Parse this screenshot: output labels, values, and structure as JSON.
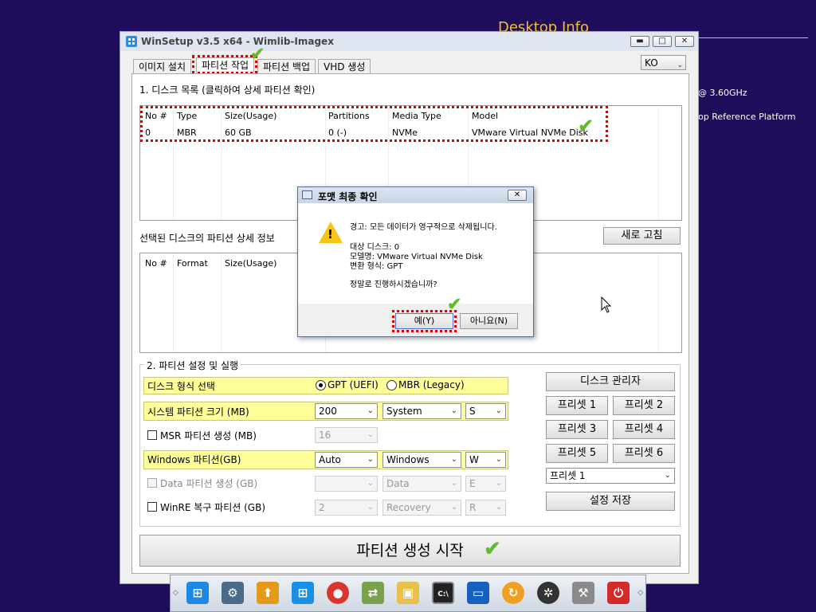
{
  "desktop": {
    "title": "Desktop Info",
    "cpu_text": "@ 3.60GHz",
    "platform_text": "op Reference Platform"
  },
  "window": {
    "title": "WinSetup v3.5 x64 - Wimlib-Imagex",
    "language": "KO",
    "tabs": [
      "이미지 설치",
      "파티션 작업",
      "파티션 백업",
      "VHD 생성"
    ],
    "active_tab": 1
  },
  "disk_list": {
    "section_label": "1. 디스크 목록 (클릭하여 상세 파티션 확인)",
    "columns": [
      "No #",
      "Type",
      "Size(Usage)",
      "Partitions",
      "Media Type",
      "Model"
    ],
    "rows": [
      [
        "0",
        "MBR",
        "60 GB",
        "0 (-)",
        "NVMe",
        "VMware Virtual NVMe Disk"
      ]
    ]
  },
  "partition_detail": {
    "section_label": "선택된 디스크의 파티션 상세 정보",
    "columns": [
      "No #",
      "Format",
      "Size(Usage)"
    ],
    "refresh_button": "새로 고침"
  },
  "settings": {
    "group_label": "2. 파티션 설정 및 실행",
    "disk_format_label": "디스크 형식 선택",
    "gpt_option": "GPT (UEFI)",
    "mbr_option": "MBR (Legacy)",
    "selected_format": "GPT",
    "system_partition_label": "시스템 파티션 크기 (MB)",
    "system_size": "200",
    "system_label": "System",
    "system_letter": "S",
    "msr_label": "MSR 파티션 생성 (MB)",
    "msr_size": "16",
    "windows_label": "Windows 파티션(GB)",
    "windows_size": "Auto",
    "windows_name": "Windows",
    "windows_letter": "W",
    "data_label": "Data 파티션 생성 (GB)",
    "data_size": "",
    "data_name": "Data",
    "data_letter": "E",
    "winre_label": "WinRE 복구 파티션 (GB)",
    "winre_size": "2",
    "winre_name": "Recovery",
    "winre_letter": "R",
    "disk_manager_button": "디스크 관리자",
    "presets": [
      "프리셋 1",
      "프리셋 2",
      "프리셋 3",
      "프리셋 4",
      "프리셋 5",
      "프리셋 6"
    ],
    "preset_select": "프리셋 1",
    "save_button": "설정 저장",
    "start_button": "파티션 생성 시작"
  },
  "dialog": {
    "title": "포맷 최종 확인",
    "warning": "경고: 모든 데이터가 영구적으로 삭제됩니다.",
    "target_disk": "대상 디스크: 0",
    "model": "모델명: VMware Virtual NVMe Disk",
    "conversion": "변환 형식: GPT",
    "question": "정말로 진행하시겠습니까?",
    "yes_button": "예(Y)",
    "no_button": "아니요(N)"
  },
  "taskbar": {
    "icons": [
      "windows-setup-icon",
      "disk-tools-icon",
      "usb-installer-icon",
      "windows-logo-icon",
      "chat-icon",
      "network-icon",
      "explorer-icon",
      "command-prompt-icon",
      "monitor-icon",
      "refresh-icon",
      "settings-icon",
      "tools-icon",
      "power-icon"
    ]
  }
}
